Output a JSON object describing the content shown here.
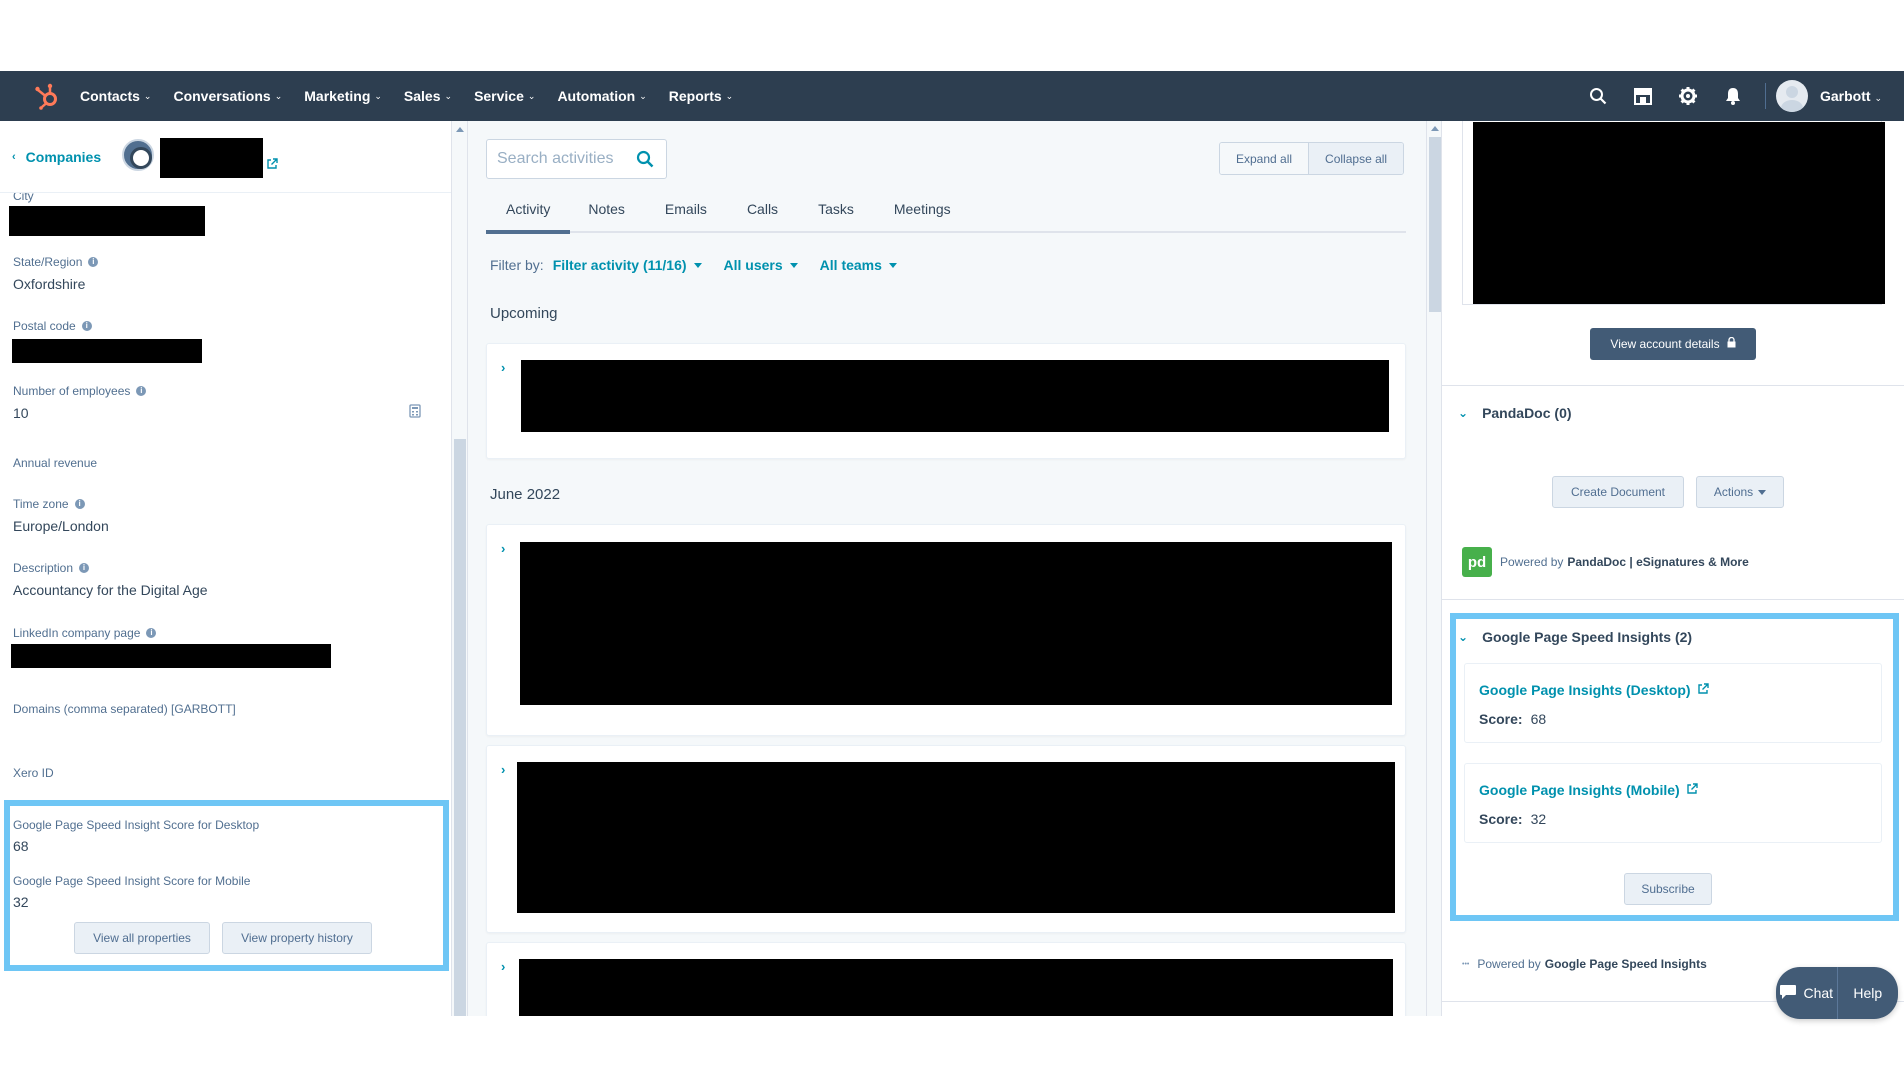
{
  "nav": {
    "menu": [
      {
        "label": "Contacts"
      },
      {
        "label": "Conversations"
      },
      {
        "label": "Marketing"
      },
      {
        "label": "Sales"
      },
      {
        "label": "Service"
      },
      {
        "label": "Automation"
      },
      {
        "label": "Reports"
      }
    ],
    "user_name": "Garbott",
    "icons": [
      "search-icon",
      "marketplace-icon",
      "settings-icon",
      "notifications-icon"
    ],
    "bg_color": "#2d3e50"
  },
  "left": {
    "back_label": "Companies",
    "properties": [
      {
        "label": "City",
        "value": ""
      },
      {
        "label": "State/Region",
        "value": "Oxfordshire"
      },
      {
        "label": "Postal code",
        "value": ""
      },
      {
        "label": "Number of employees",
        "value": "10"
      },
      {
        "label": "Annual revenue",
        "value": ""
      },
      {
        "label": "Time zone",
        "value": "Europe/London"
      },
      {
        "label": "Description",
        "value": "Accountancy for the Digital Age"
      },
      {
        "label": "LinkedIn company page",
        "value": ""
      },
      {
        "label": "Domains (comma separated) [GARBOTT]",
        "value": ""
      },
      {
        "label": "Xero ID",
        "value": ""
      },
      {
        "label": "Google Page Speed Insight Score for Desktop",
        "value": "68"
      },
      {
        "label": "Google Page Speed Insight Score for Mobile",
        "value": "32"
      }
    ],
    "buttons": {
      "view_all": "View all properties",
      "history": "View property history"
    }
  },
  "center": {
    "search_placeholder": "Search activities",
    "expand_all": "Expand all",
    "collapse_all": "Collapse all",
    "tabs": [
      {
        "label": "Activity"
      },
      {
        "label": "Notes"
      },
      {
        "label": "Emails"
      },
      {
        "label": "Calls"
      },
      {
        "label": "Tasks"
      },
      {
        "label": "Meetings"
      }
    ],
    "filter_by": "Filter by:",
    "filters": [
      {
        "label": "Filter activity (11/16)"
      },
      {
        "label": "All users"
      },
      {
        "label": "All teams"
      }
    ],
    "sections": {
      "upcoming": "Upcoming",
      "month": "June 2022"
    }
  },
  "right": {
    "view_account": "View account details",
    "pandadoc": {
      "title": "PandaDoc (0)",
      "create": "Create Document",
      "actions": "Actions",
      "powered_by": "Powered by",
      "provider": "PandaDoc | eSignatures & More"
    },
    "speed": {
      "title": "Google Page Speed Insights (2)",
      "cards": [
        {
          "title": "Google Page Insights (Desktop)",
          "score_label": "Score:",
          "score": "68"
        },
        {
          "title": "Google Page Insights (Mobile)",
          "score_label": "Score:",
          "score": "32"
        }
      ],
      "subscribe": "Subscribe",
      "powered_by": "Powered by",
      "provider": "Google Page Speed Insights"
    },
    "highlight_color": "#6ec6f5"
  },
  "chat": {
    "chat_label": "Chat",
    "help_label": "Help"
  }
}
